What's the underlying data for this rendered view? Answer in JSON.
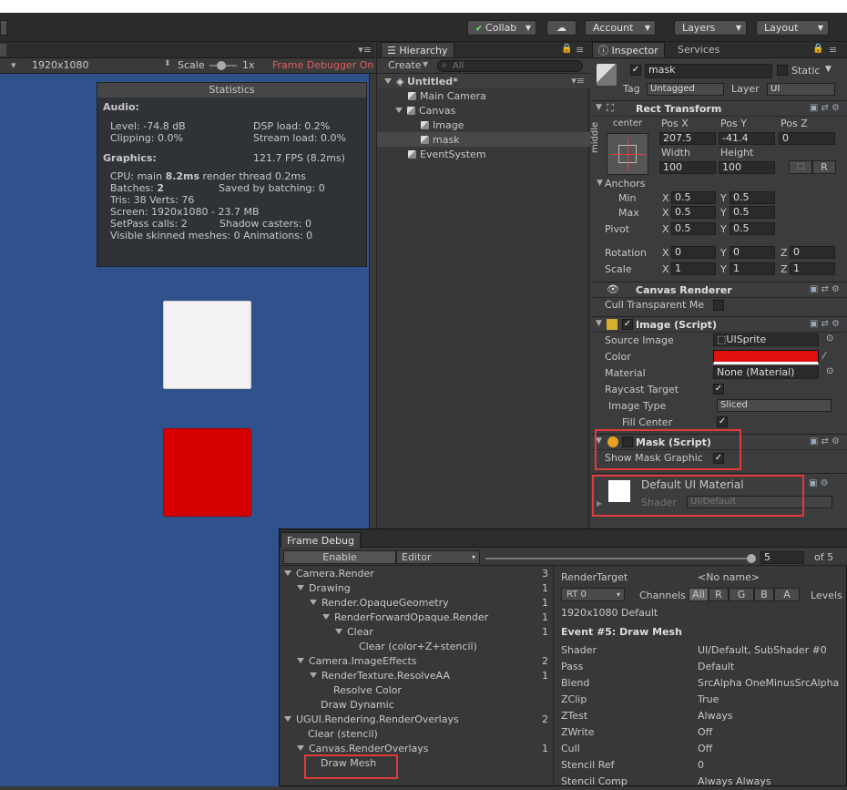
{
  "toolbar": {
    "collab": "Collab",
    "account": "Account",
    "layers": "Layers",
    "layout": "Layout"
  },
  "game": {
    "resolution": "1920x1080",
    "scale_label": "Scale",
    "scale_value": "1x",
    "frame_debugger": "Frame Debugger On"
  },
  "stats": {
    "title": "Statistics",
    "audio_heading": "Audio:",
    "level": "Level: -74.8 dB",
    "dsp": "DSP load: 0.2%",
    "clipping": "Clipping: 0.0%",
    "stream": "Stream load: 0.0%",
    "graphics_heading": "Graphics:",
    "fps": "121.7 FPS (8.2ms)",
    "cpu_prefix": "CPU: main ",
    "cpu_main": "8.2ms",
    "cpu_suffix": "  render thread 0.2ms",
    "batches_prefix": "Batches: ",
    "batches": "2",
    "saved": "Saved by batching: 0",
    "tris": "Tris: 38   Verts: 76",
    "screen": "Screen: 1920x1080 - 23.7 MB",
    "setpass": "SetPass calls: 2",
    "shadow": "Shadow casters: 0",
    "skinned": "Visible skinned meshes: 0  Animations: 0"
  },
  "hierarchy": {
    "tab": "Hierarchy",
    "create": "Create",
    "search_placeholder": "All",
    "scene": "Untitled*",
    "items": [
      "Main Camera",
      "Canvas",
      "Image",
      "mask",
      "EventSystem"
    ]
  },
  "inspector": {
    "tab_inspector": "Inspector",
    "tab_services": "Services",
    "object_name": "mask",
    "static_label": "Static",
    "tag_label": "Tag",
    "tag_value": "Untagged",
    "layer_label": "Layer",
    "layer_value": "UI",
    "rect_transform": {
      "title": "Rect Transform",
      "center": "center",
      "middle": "middle",
      "posx_label": "Pos X",
      "posy_label": "Pos Y",
      "posz_label": "Pos Z",
      "posx": "207.5",
      "posy": "-41.4",
      "posz": "0",
      "width_label": "Width",
      "height_label": "Height",
      "width": "100",
      "height": "100",
      "r_button": "R",
      "anchors": "Anchors",
      "min": "Min",
      "max": "Max",
      "pivot": "Pivot",
      "x": "X",
      "y": "Y",
      "z": "Z",
      "min_x": "0.5",
      "min_y": "0.5",
      "max_x": "0.5",
      "max_y": "0.5",
      "pivot_x": "0.5",
      "pivot_y": "0.5",
      "rotation": "Rotation",
      "rot_x": "0",
      "rot_y": "0",
      "rot_z": "0",
      "scale": "Scale",
      "scale_x": "1",
      "scale_y": "1",
      "scale_z": "1"
    },
    "canvas_renderer": {
      "title": "Canvas Renderer",
      "cull": "Cull Transparent Me"
    },
    "image_script": {
      "title": "Image (Script)",
      "source_image_label": "Source Image",
      "source_image": "UISprite",
      "color_label": "Color",
      "color": "#e01010",
      "material_label": "Material",
      "material": "None (Material)",
      "raycast_label": "Raycast Target",
      "image_type_label": "Image Type",
      "image_type": "Sliced",
      "fill_center_label": "Fill Center"
    },
    "mask_script": {
      "title": "Mask (Script)",
      "show_graphic": "Show Mask Graphic"
    },
    "material": {
      "name": "Default UI Material",
      "shader_label": "Shader",
      "shader": "UI/Default"
    }
  },
  "frame_debug": {
    "title": "Frame Debug",
    "enable": "Enable",
    "editor": "Editor",
    "event_index": "5",
    "of_total": "of 5",
    "tree": [
      {
        "label": "Camera.Render",
        "count": "3",
        "indent": 0,
        "arrow": true
      },
      {
        "label": "Drawing",
        "count": "1",
        "indent": 1,
        "arrow": true
      },
      {
        "label": "Render.OpaqueGeometry",
        "count": "1",
        "indent": 2,
        "arrow": true
      },
      {
        "label": "RenderForwardOpaque.Render",
        "count": "1",
        "indent": 3,
        "arrow": true
      },
      {
        "label": "Clear",
        "count": "1",
        "indent": 4,
        "arrow": true
      },
      {
        "label": "Clear (color+Z+stencil)",
        "count": "",
        "indent": 5,
        "arrow": false
      },
      {
        "label": "Camera.ImageEffects",
        "count": "2",
        "indent": 1,
        "arrow": true
      },
      {
        "label": "RenderTexture.ResolveAA",
        "count": "1",
        "indent": 2,
        "arrow": true
      },
      {
        "label": "Resolve Color",
        "count": "",
        "indent": 3,
        "arrow": false
      },
      {
        "label": "Draw Dynamic",
        "count": "",
        "indent": 2,
        "arrow": false
      },
      {
        "label": "UGUI.Rendering.RenderOverlays",
        "count": "2",
        "indent": 0,
        "arrow": true
      },
      {
        "label": "Clear (stencil)",
        "count": "",
        "indent": 1,
        "arrow": false
      },
      {
        "label": "Canvas.RenderOverlays",
        "count": "1",
        "indent": 1,
        "arrow": true
      },
      {
        "label": "Draw Mesh",
        "count": "",
        "indent": 2,
        "arrow": false
      }
    ],
    "render_target_label": "RenderTarget",
    "render_target": "<No name>",
    "rt": "RT 0",
    "channels": "Channels",
    "channel_buttons": [
      "All",
      "R",
      "G",
      "B",
      "A"
    ],
    "levels": "Levels",
    "resolution": "1920x1080 Default",
    "event_title": "Event #5: Draw Mesh",
    "props": [
      {
        "k": "Shader",
        "v": "UI/Default, SubShader #0"
      },
      {
        "k": "Pass",
        "v": "Default"
      },
      {
        "k": "Blend",
        "v": "SrcAlpha OneMinusSrcAlpha"
      },
      {
        "k": "ZClip",
        "v": "True"
      },
      {
        "k": "ZTest",
        "v": "Always"
      },
      {
        "k": "ZWrite",
        "v": "Off"
      },
      {
        "k": "Cull",
        "v": "Off"
      },
      {
        "k": "Stencil Ref",
        "v": "0"
      },
      {
        "k": "Stencil Comp",
        "v": "Always Always"
      }
    ]
  }
}
